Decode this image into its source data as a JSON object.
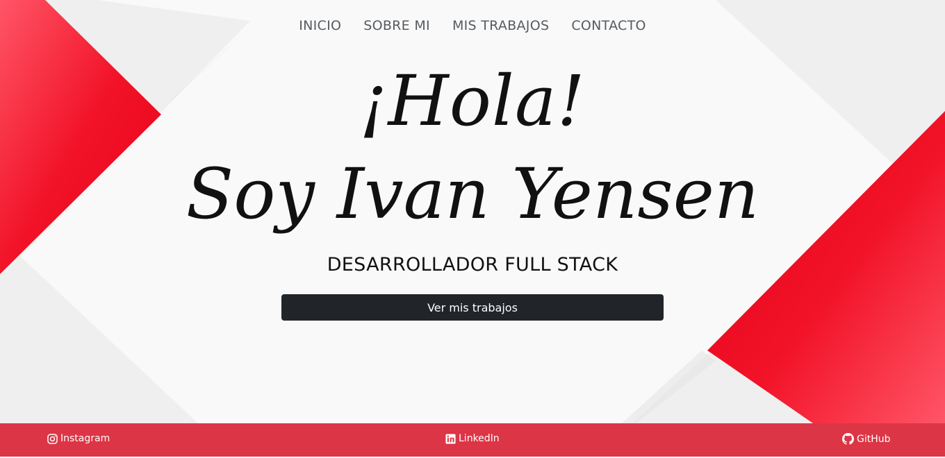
{
  "nav": {
    "items": [
      {
        "label": "INICIO"
      },
      {
        "label": "SOBRE MI"
      },
      {
        "label": "MIS TRABAJOS"
      },
      {
        "label": "CONTACTO"
      }
    ]
  },
  "hero": {
    "greeting": "¡Hola!",
    "name_line": "Soy Ivan Yensen",
    "subtitle": "DESARROLLADOR FULL STACK",
    "cta_label": "Ver mis trabajos"
  },
  "footer": {
    "links": [
      {
        "label": "Instagram",
        "icon": "instagram-icon"
      },
      {
        "label": "LinkedIn",
        "icon": "linkedin-icon"
      },
      {
        "label": "GitHub",
        "icon": "github-icon"
      }
    ]
  },
  "colors": {
    "accent_red": "#dc3545",
    "bright_red": "#f01025",
    "button_dark": "#212529",
    "background_light": "#f9f9f9"
  }
}
